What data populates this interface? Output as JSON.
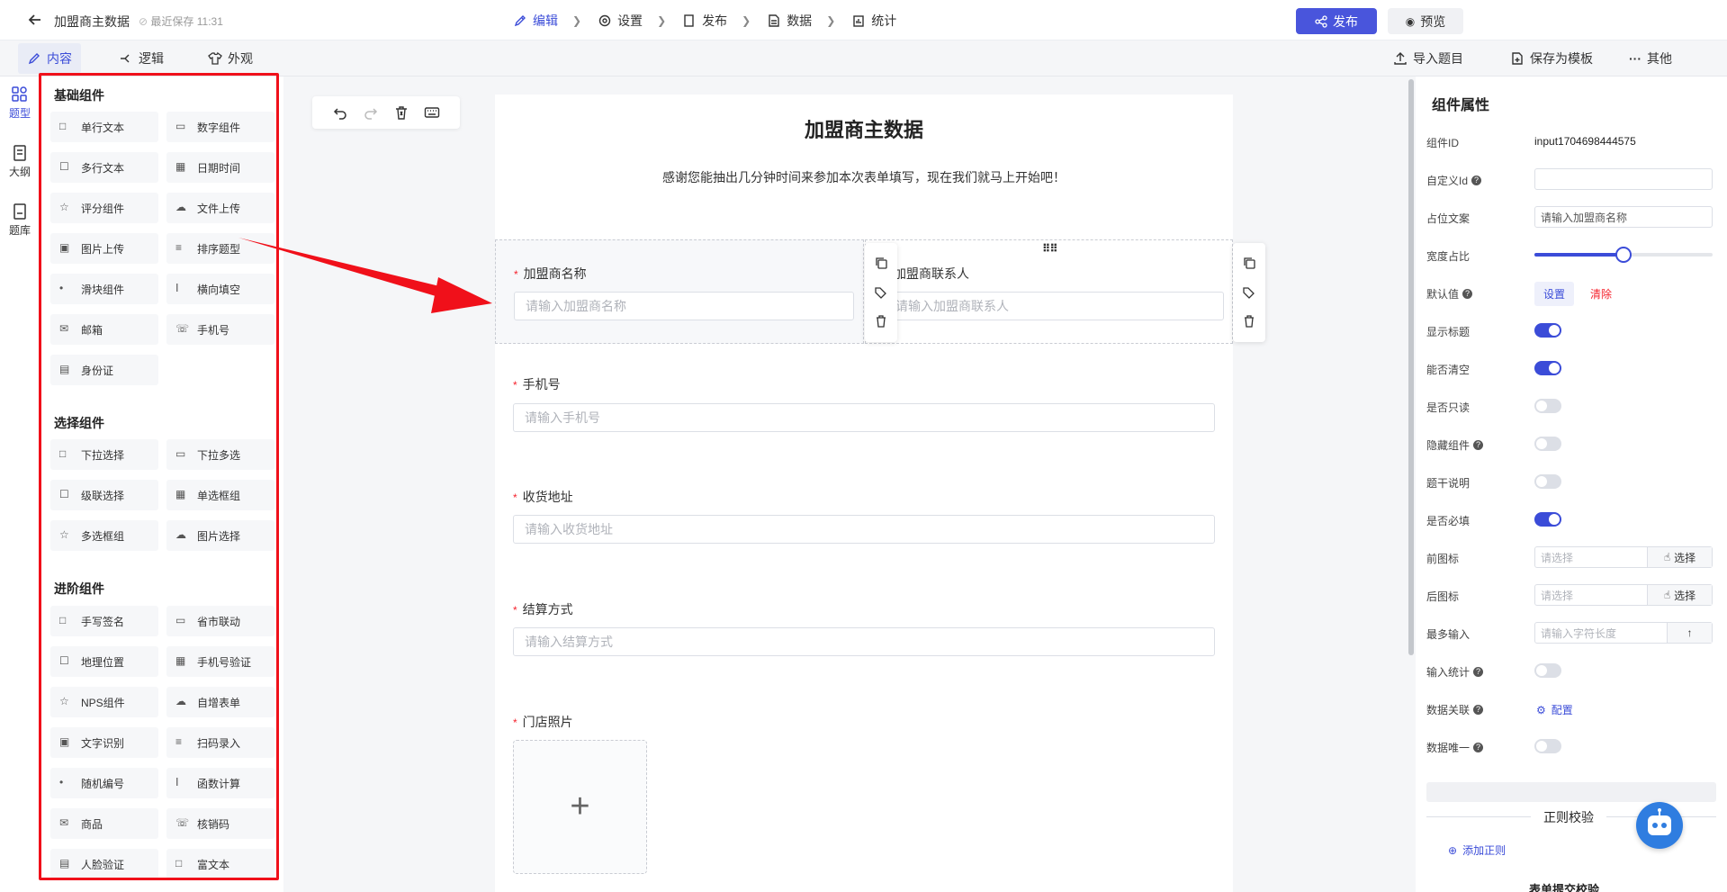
{
  "topbar": {
    "title": "加盟商主数据",
    "saved": "最近保存 11:31",
    "steps": [
      "编辑",
      "设置",
      "发布",
      "数据",
      "统计"
    ],
    "publish": "发布",
    "preview": "预览"
  },
  "subbar": {
    "tabs": [
      "内容",
      "逻辑",
      "外观"
    ],
    "import": "导入题目",
    "save_template": "保存为模板",
    "more": "其他"
  },
  "rail": [
    "题型",
    "大纲",
    "题库"
  ],
  "palette": {
    "basic_title": "基础组件",
    "basic": [
      "单行文本",
      "数字组件",
      "多行文本",
      "日期时间",
      "评分组件",
      "文件上传",
      "图片上传",
      "排序题型",
      "滑块组件",
      "横向填空",
      "邮箱",
      "手机号",
      "身份证"
    ],
    "select_title": "选择组件",
    "select": [
      "下拉选择",
      "下拉多选",
      "级联选择",
      "单选框组",
      "多选框组",
      "图片选择"
    ],
    "adv_title": "进阶组件",
    "adv": [
      "手写签名",
      "省市联动",
      "地理位置",
      "手机号验证",
      "NPS组件",
      "自增表单",
      "文字识别",
      "扫码录入",
      "随机编号",
      "函数计算",
      "商品",
      "核销码",
      "人脸验证",
      "富文本"
    ]
  },
  "form": {
    "title": "加盟商主数据",
    "desc": "感谢您能抽出几分钟时间来参加本次表单填写，现在我们就马上开始吧！",
    "fields": [
      {
        "label": "加盟商名称",
        "placeholder": "请输入加盟商名称"
      },
      {
        "label": "加盟商联系人",
        "placeholder": "请输入加盟商联系人"
      },
      {
        "label": "手机号",
        "placeholder": "请输入手机号"
      },
      {
        "label": "收货地址",
        "placeholder": "请输入收货地址"
      },
      {
        "label": "结算方式",
        "placeholder": "请输入结算方式"
      },
      {
        "label": "门店照片",
        "placeholder": ""
      }
    ],
    "required_mark": "*"
  },
  "props": {
    "title": "组件属性",
    "rows": [
      {
        "label": "组件ID",
        "value": "input1704698444575"
      },
      {
        "label": "自定义Id",
        "value": ""
      },
      {
        "label": "占位文案",
        "value": "请输入加盟商名称"
      },
      {
        "label": "宽度占比",
        "value": 50
      },
      {
        "label": "默认值",
        "set": "设置",
        "clear": "清除"
      },
      {
        "label": "显示标题",
        "on": true
      },
      {
        "label": "能否清空",
        "on": true
      },
      {
        "label": "是否只读",
        "on": false
      },
      {
        "label": "隐藏组件",
        "on": false
      },
      {
        "label": "题干说明",
        "on": false
      },
      {
        "label": "是否必填",
        "on": true
      },
      {
        "label": "前图标",
        "placeholder": "请选择",
        "button": "选择"
      },
      {
        "label": "后图标",
        "placeholder": "请选择",
        "button": "选择"
      },
      {
        "label": "最多输入",
        "placeholder": "请输入字符长度"
      },
      {
        "label": "输入统计",
        "on": false
      },
      {
        "label": "数据关联",
        "link": "配置"
      },
      {
        "label": "数据唯一",
        "on": false
      }
    ],
    "divider": "正则校验",
    "add_rule": "添加正则",
    "cut_text": "表单提交校验"
  },
  "colors": {
    "accent": "#4955dc",
    "red": "#f0101a"
  }
}
